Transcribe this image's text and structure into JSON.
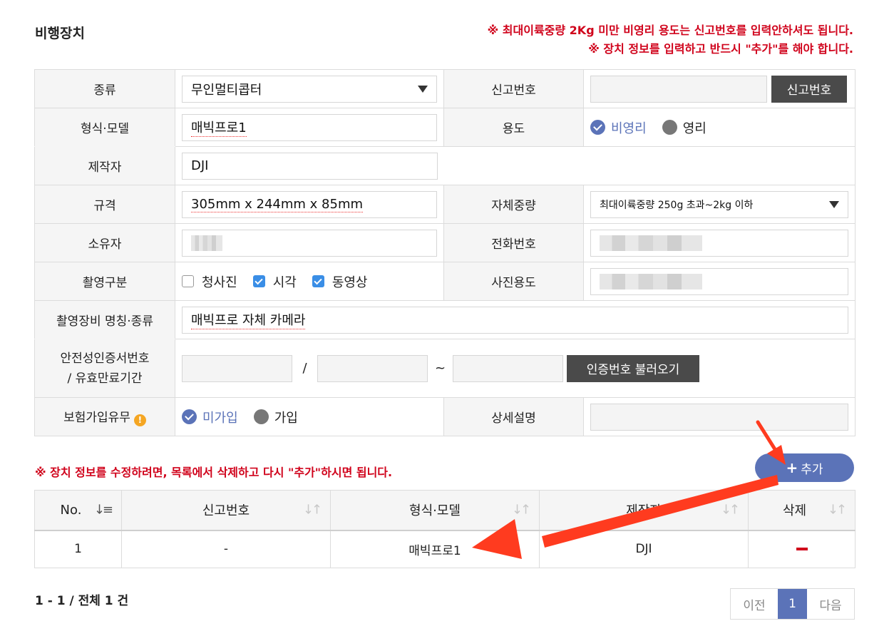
{
  "section_title": "비행장치",
  "notices": {
    "line1": "※ 최대이륙중량 2Kg 미만 비영리 용도는 신고번호를 입력안하셔도 됩니다.",
    "line2": "※ 장치 정보를 입력하고 반드시 \"추가\"를 해야 합니다."
  },
  "form": {
    "type_label": "종류",
    "type_value": "무인멀티콥터",
    "report_no_label": "신고번호",
    "report_no_value": "",
    "report_no_button": "신고번호",
    "model_label": "형식·모델",
    "model_value": "매빅프로1",
    "usage_label": "용도",
    "usage_options": [
      "비영리",
      "영리"
    ],
    "usage_selected": "비영리",
    "maker_label": "제작자",
    "maker_value": "DJI",
    "spec_label": "규격",
    "spec_value": "305mm x 244mm x 85mm",
    "weight_label": "자체중량",
    "weight_value": "최대이륙중량 250g 초과~2kg 이하",
    "owner_label": "소유자",
    "phone_label": "전화번호",
    "shoot_type_label": "촬영구분",
    "shoot_types": [
      {
        "label": "청사진",
        "checked": false
      },
      {
        "label": "시각",
        "checked": true
      },
      {
        "label": "동영상",
        "checked": true
      }
    ],
    "photo_usage_label": "사진용도",
    "equipment_label": "촬영장비 명칭·종류",
    "equipment_value": "매빅프로 자체 카메라",
    "cert_label_line1": "안전성인증서번호",
    "cert_label_line2": "/ 유효만료기간",
    "cert_sep1": "/",
    "cert_sep2": "~",
    "cert_button": "인증번호 불러오기",
    "insurance_label": "보험가입유무",
    "insurance_options": [
      "미가입",
      "가입"
    ],
    "insurance_selected": "미가입",
    "detail_label": "상세설명",
    "detail_value": ""
  },
  "edit_notice": "※ 장치 정보를 수정하려면, 목록에서 삭제하고 다시 \"추가\"하시면 됩니다.",
  "add_button": "추가",
  "list": {
    "columns": [
      "No.",
      "신고번호",
      "형식·모델",
      "제작자",
      "삭제"
    ],
    "rows": [
      {
        "no": "1",
        "report_no": "-",
        "model": "매빅프로1",
        "maker": "DJI"
      }
    ]
  },
  "pagination": {
    "info": "1 - 1 / 전체 1 건",
    "prev": "이전",
    "current": "1",
    "next": "다음"
  },
  "colors": {
    "accent": "#5b73b8",
    "notice_red": "#d0021b",
    "annotation_arrow": "#ff3b1f"
  }
}
